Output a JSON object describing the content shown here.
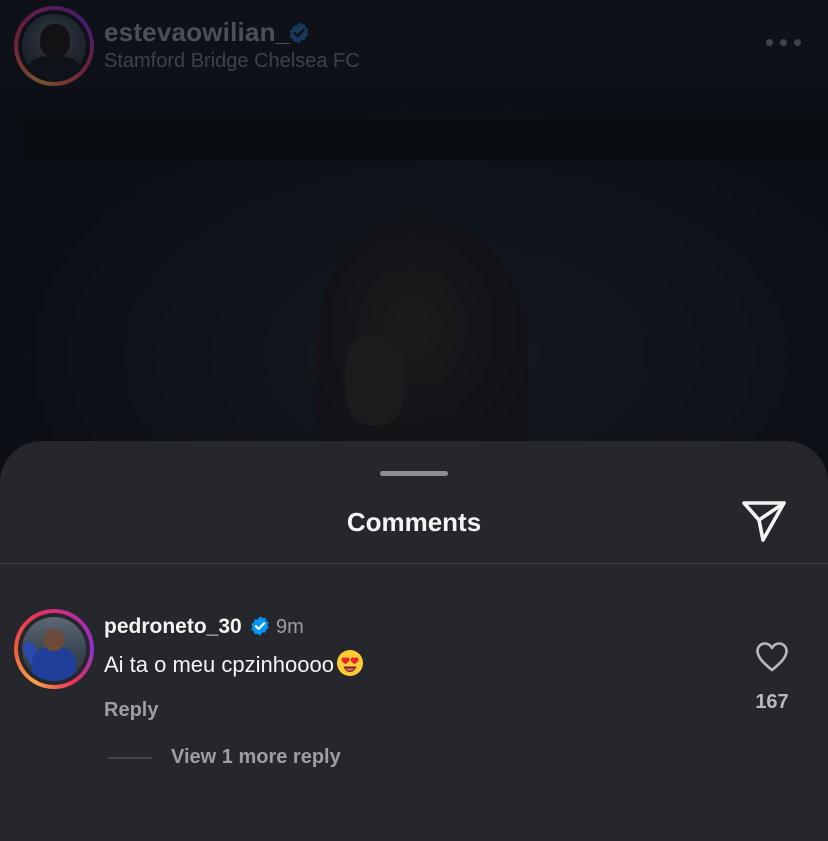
{
  "post": {
    "username": "estevaowilian_",
    "location": "Stamford Bridge Chelsea FC",
    "verified": true
  },
  "sheet": {
    "title": "Comments"
  },
  "comment": {
    "username": "pedroneto_30",
    "verified": true,
    "time": "9m",
    "text": "Ai ta o meu cpzinhoooo",
    "emoji": "heart-eyes-emoji",
    "reply_label": "Reply",
    "like_count": "167",
    "view_replies_label": "View 1 more reply"
  },
  "colors": {
    "verified_blue": "#0095f6",
    "sheet_bg": "#25272c",
    "text_primary": "#f4f4f5",
    "text_secondary": "#9b9ea4"
  }
}
